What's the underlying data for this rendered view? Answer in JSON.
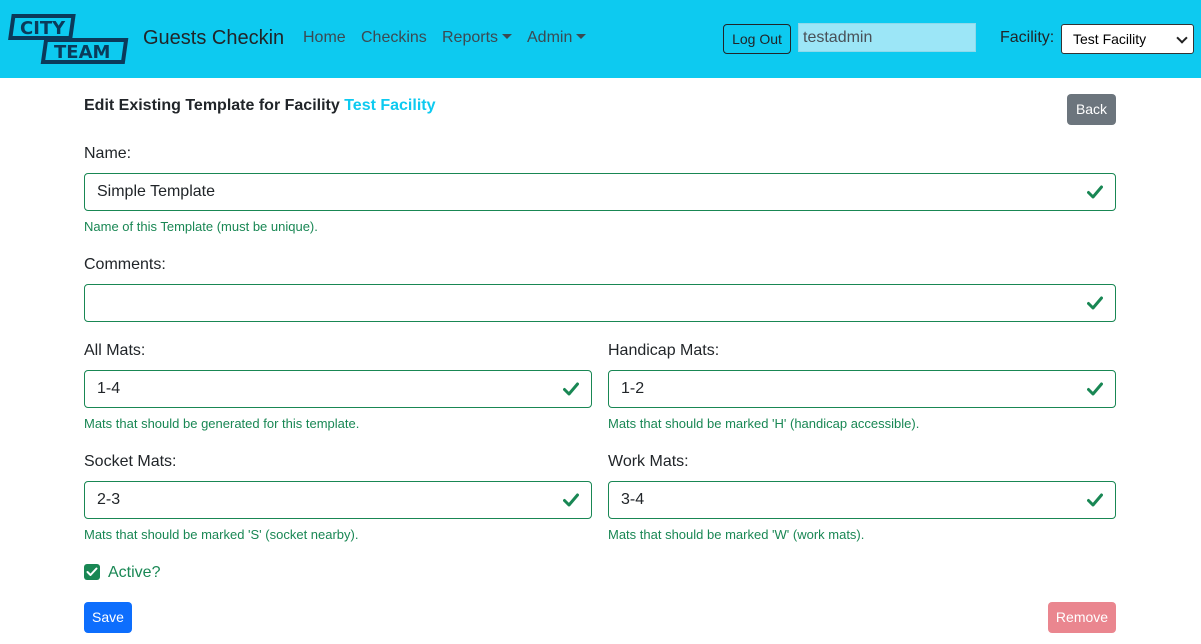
{
  "navbar": {
    "logo_text_1": "CITY",
    "logo_text_2": "TEAM",
    "brand": "Guests Checkin",
    "links": [
      "Home",
      "Checkins",
      "Reports",
      "Admin"
    ],
    "logout_label": "Log Out",
    "username": "testadmin",
    "facility_label": "Facility:",
    "facility_selected": "Test Facility",
    "background_color": "#0dcaf0"
  },
  "page": {
    "title_prefix": "Edit Existing Template for Facility",
    "title_facility": "Test Facility",
    "back_label": "Back"
  },
  "form": {
    "name": {
      "label": "Name:",
      "value": "Simple Template",
      "help": "Name of this Template (must be unique)."
    },
    "comments": {
      "label": "Comments:",
      "value": ""
    },
    "all_mats": {
      "label": "All Mats:",
      "value": "1-4",
      "help": "Mats that should be generated for this template."
    },
    "handicap_mats": {
      "label": "Handicap Mats:",
      "value": "1-2",
      "help": "Mats that should be marked 'H' (handicap accessible)."
    },
    "socket_mats": {
      "label": "Socket Mats:",
      "value": "2-3",
      "help": "Mats that should be marked 'S' (socket nearby)."
    },
    "work_mats": {
      "label": "Work Mats:",
      "value": "3-4",
      "help": "Mats that should be marked 'W' (work mats)."
    },
    "active": {
      "label": "Active?",
      "checked": true
    },
    "save_label": "Save",
    "remove_label": "Remove"
  },
  "colors": {
    "valid_green": "#198754",
    "primary_blue": "#0d6efd",
    "danger_light": "#ea868f",
    "secondary_gray": "#6c757d"
  }
}
